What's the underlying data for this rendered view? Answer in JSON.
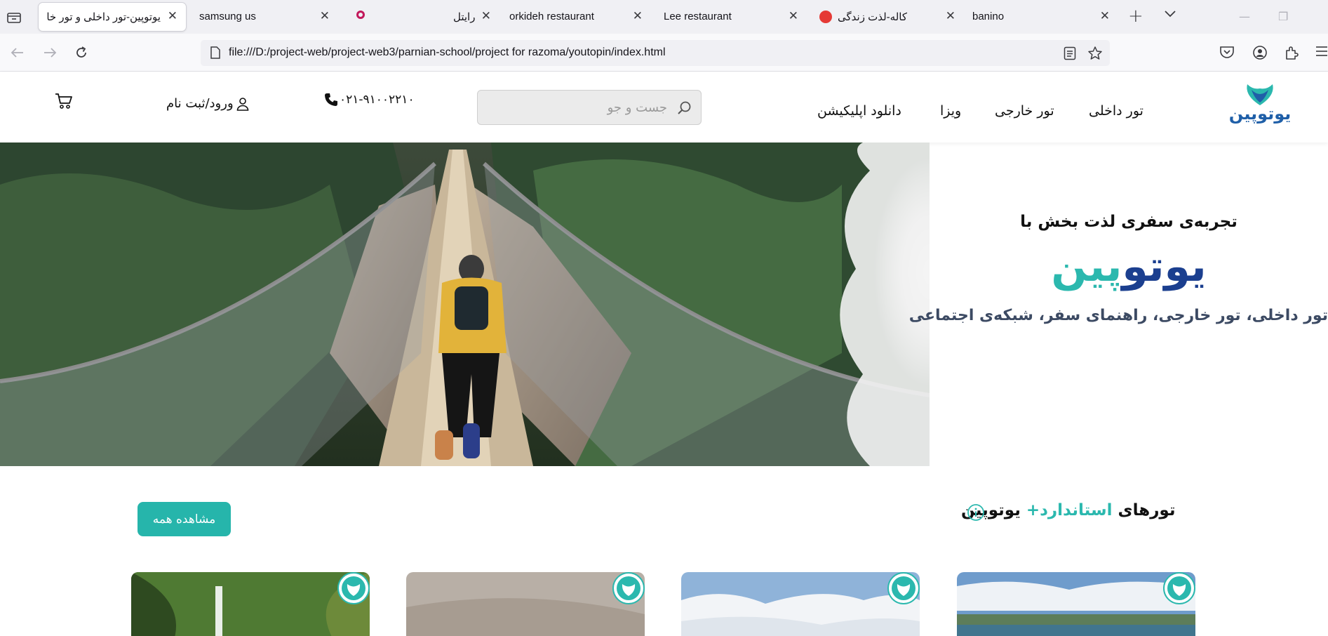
{
  "browser": {
    "tabs": [
      {
        "title": "یوتوپین-تور داخلی و تور خا",
        "active": true
      },
      {
        "title": "samsung us",
        "active": false
      },
      {
        "title": "رایتل",
        "active": false
      },
      {
        "title": "orkideh restaurant",
        "active": false
      },
      {
        "title": "Lee restaurant",
        "active": false
      },
      {
        "title": "کاله-لذت زندگی",
        "active": false
      },
      {
        "title": "banino",
        "active": false
      }
    ],
    "url": "file:///D:/project-web/project-web3/parnian-school/project for razoma/youtopin/index.html"
  },
  "header": {
    "logo_text": "یوتوپین",
    "menu": [
      "تور داخلی",
      "تور خارجی",
      "ویزا",
      "دانلود اپلیکیشن"
    ],
    "search_placeholder": "جست و جو",
    "phone": "۰۲۱-۹۱۰۰۲۲۱۰",
    "login": "ورود/ثبت نام"
  },
  "hero": {
    "tagline": "تجربه‌ی سفری لذت بخش با",
    "brand_part1": "یوتو",
    "brand_part2": "پین",
    "subtitle": "تور داخلی، تور خارجی، راهنمای سفر، شبکه‌ی اجتماعی"
  },
  "tours_section": {
    "title_prefix": "تورهای",
    "title_accent": "استاندارد+",
    "title_suffix": "یوتوپین",
    "view_all": "مشاهده همه"
  },
  "colors": {
    "brand_teal": "#2bb8ae",
    "brand_blue": "#1b3f8f",
    "button_teal": "#26b5ab"
  }
}
